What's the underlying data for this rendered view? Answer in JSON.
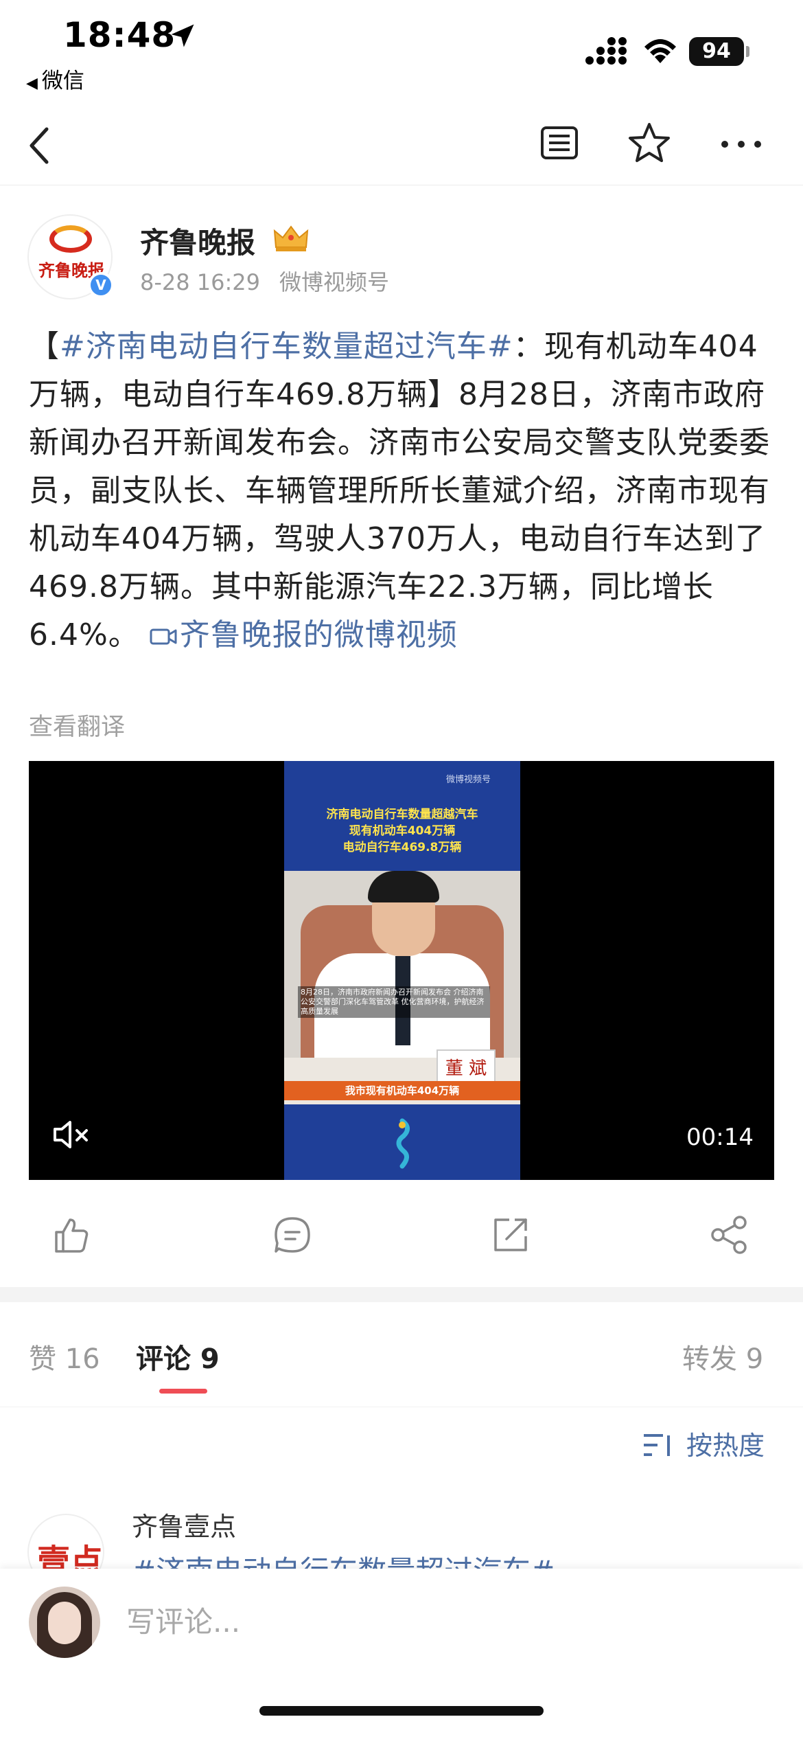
{
  "status_bar": {
    "time": "18:48",
    "back_app": "微信",
    "battery": "94"
  },
  "author": {
    "name": "齐鲁晚报",
    "date": "8-28 16:29",
    "source": "微博视频号",
    "avatar_text": "齐鲁晚报",
    "verified": "V"
  },
  "post": {
    "bracket_open": "【",
    "hashtag": "#济南电动自行车数量超过汽车#",
    "text": "：现有机动车404万辆，电动自行车469.8万辆】8月28日，济南市政府新闻办召开新闻发布会。济南市公安局交警支队党委委员，副支队长、车辆管理所所长董斌介绍，济南市现有机动车404万辆，驾驶人370万人，电动自行车达到了469.8万辆。其中新能源汽车22.3万辆，同比增长6.4%。",
    "video_link": "齐鲁晚报的微博视频",
    "translate": "查看翻译"
  },
  "video": {
    "watermark": "微博视频号",
    "title_lines": [
      "济南电动自行车数量超越汽车",
      "现有机动车404万辆",
      "电动自行车469.8万辆"
    ],
    "subtitle": "8月28日，济南市政府新闻办召开新闻发布会 介绍济南公安交警部门深化车驾管改革 优化营商环境，护航经济高质量发展",
    "nameplate": "董 斌",
    "caption": "我市现有机动车404万辆",
    "duration": "00:14"
  },
  "tabs": {
    "likes": "赞 16",
    "comments": "评论 9",
    "reposts": "转发 9"
  },
  "sort": {
    "label": "按热度"
  },
  "comment": {
    "avatar_text": "壹点",
    "name": "齐鲁壹点",
    "text": "#济南电动自行车数量超过汽车#"
  },
  "input": {
    "placeholder": "写评论..."
  },
  "colors": {
    "link": "#4d6fa5",
    "tab_underline": "#ef4d55",
    "video_bg": "#1f3f98",
    "caption_bar": "#e26120"
  }
}
